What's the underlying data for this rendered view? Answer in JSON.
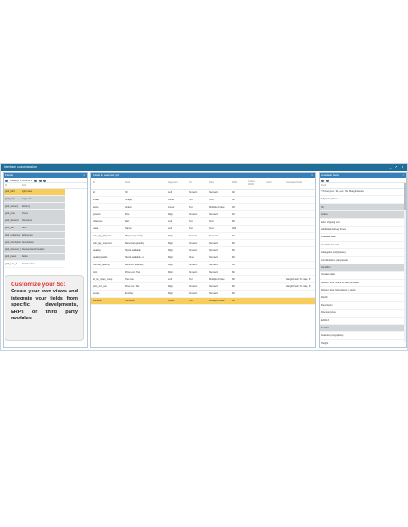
{
  "window": {
    "title": "Interface customization",
    "controls": "_ ↗ ✕"
  },
  "left_panel": {
    "header": "Fields",
    "toolbar": {
      "label": "Catalog: Products",
      "dropdown": "▾"
    },
    "columns": [
      "Id",
      "Field"
    ],
    "rows": [
      {
        "id": "grid_label",
        "field": "Light view",
        "style": "hl"
      },
      {
        "id": "grid_large",
        "field": "Large view",
        "style": "grey"
      },
      {
        "id": "grid_delivery",
        "field": "Delivery",
        "style": "grey"
      },
      {
        "id": "grid_price",
        "field": "Prices",
        "style": "grey"
      },
      {
        "id": "grid_discount",
        "field": "Discounts",
        "style": "grey"
      },
      {
        "id": "grid_seo",
        "field": "SEO",
        "style": "grey"
      },
      {
        "id": "grid_reference",
        "field": "References",
        "style": "grey"
      },
      {
        "id": "grid_description",
        "field": "Descriptions",
        "style": "grey"
      },
      {
        "id": "grid_discount_headers",
        "field": "Discounts and headers",
        "style": "grey"
      },
      {
        "id": "grid_packs",
        "field": "Packs",
        "style": "grey"
      },
      {
        "id": "grid_user_1",
        "field": "Custom view",
        "style": ""
      }
    ]
  },
  "promo": {
    "title": "Customize your Sc:",
    "body": "Create your own views and integrate your fields from specific develpments, ERPs or third party modules"
  },
  "center_panel": {
    "header": "Fields in selected grid",
    "columns": [
      "ID",
      "Field",
      "Alignment",
      "Sort",
      "Filter",
      "Width",
      "Column Width",
      "Color",
      "Associated fields"
    ],
    "rows": [
      {
        "id": "id",
        "field": "ID",
        "align": "Left",
        "sort": "Numeric",
        "filter": "Numeric",
        "width": "40",
        "assoc": "",
        "style": ""
      },
      {
        "id": "image",
        "field": "Image",
        "align": "Center",
        "sort": "Text",
        "filter": "Text",
        "width": "60",
        "assoc": "",
        "style": ""
      },
      {
        "id": "active",
        "field": "Active",
        "align": "Center",
        "sort": "Text",
        "filter": "Multiple choice",
        "width": "45",
        "assoc": "",
        "style": ""
      },
      {
        "id": "position",
        "field": "Pos.",
        "align": "Right",
        "sort": "Numeric",
        "filter": "Numeric",
        "width": "40",
        "assoc": "",
        "style": ""
      },
      {
        "id": "reference",
        "field": "Ref.",
        "align": "Left",
        "sort": "Text",
        "filter": "Text",
        "width": "80",
        "assoc": "",
        "style": ""
      },
      {
        "id": "name",
        "field": "Name",
        "align": "Left",
        "sort": "Text",
        "filter": "Text",
        "width": "200",
        "assoc": "",
        "style": ""
      },
      {
        "id": "sold_qty_physical",
        "field": "Physical quantity",
        "align": "Right",
        "sort": "Numeric",
        "filter": "Numeric",
        "width": "60",
        "assoc": "",
        "style": ""
      },
      {
        "id": "sold_qty_reserved",
        "field": "Reserved quantity",
        "align": "Right",
        "sort": "Numeric",
        "filter": "Numeric",
        "width": "60",
        "assoc": "",
        "style": ""
      },
      {
        "id": "quantity",
        "field": "Stock available",
        "align": "Right",
        "sort": "Numeric",
        "filter": "Numeric",
        "width": "60",
        "assoc": "",
        "style": ""
      },
      {
        "id": "quantityupdate",
        "field": "Stock available +/-",
        "align": "Right",
        "sort": "None",
        "filter": "Numeric",
        "width": "60",
        "assoc": "",
        "style": ""
      },
      {
        "id": "minimal_quantity",
        "field": "Minimum quantity",
        "align": "Right",
        "sort": "Numeric",
        "filter": "Numeric",
        "width": "60",
        "assoc": "",
        "style": ""
      },
      {
        "id": "price",
        "field": "Price excl. Tax",
        "align": "Right",
        "sort": "Numeric",
        "filter": "Numeric",
        "width": "60",
        "assoc": "",
        "style": ""
      },
      {
        "id": "id_tax_rules_group",
        "field": "Tax rule",
        "align": "Left",
        "sort": "Text",
        "filter": "Multiple choice",
        "width": "60",
        "assoc": "tiangle/Cost/ Tax rate, P",
        "style": ""
      },
      {
        "id": "price_inc_tax",
        "field": "Price incl. Tax",
        "align": "Right",
        "sort": "Numeric",
        "filter": "Numeric",
        "width": "60",
        "assoc": "tiangle/Cost/ Tax rate, P",
        "style": ""
      },
      {
        "id": "ecotax",
        "field": "EcoTax",
        "align": "Right",
        "sort": "Numeric",
        "filter": "Numeric",
        "width": "60",
        "assoc": "",
        "style": ""
      },
      {
        "id": "condition",
        "field": "Condition",
        "align": "Center",
        "sort": "Text",
        "filter": "Multiple choice",
        "width": "60",
        "assoc": "",
        "style": "hl"
      }
    ]
  },
  "right_panel": {
    "header": "Available fields",
    "column": "Field",
    "rows": [
      {
        "label": "* Prices (exc. Tax, exc. Tax, Margin, Ecota",
        "style": ""
      },
      {
        "label": "* Specific prices",
        "style": ""
      },
      {
        "label": "ID",
        "style": "grey"
      },
      {
        "label": "Active",
        "style": "grey"
      },
      {
        "label": "Add. shipping cost",
        "style": ""
      },
      {
        "label": "Additional delivery times",
        "style": ""
      },
      {
        "label": "Available date",
        "style": ""
      },
      {
        "label": "Available for order",
        "style": ""
      },
      {
        "label": "Categories (copy/paste)",
        "style": ""
      },
      {
        "label": "Combinations (copy/paste)",
        "style": ""
      },
      {
        "label": "Condition",
        "style": "grey"
      },
      {
        "label": "Creation date",
        "style": ""
      },
      {
        "label": "Delivery time for out of stock products",
        "style": ""
      },
      {
        "label": "Delivery time for products in stock",
        "style": ""
      },
      {
        "label": "Depth",
        "style": ""
      },
      {
        "label": "Description",
        "style": ""
      },
      {
        "label": "Discount price",
        "style": ""
      },
      {
        "label": "EAN13",
        "style": ""
      },
      {
        "label": "EcoTax",
        "style": "grey"
      },
      {
        "label": "Features (copy/paste)",
        "style": ""
      },
      {
        "label": "Height",
        "style": ""
      },
      {
        "label": "Id_product_redirected / Id_category_redirected",
        "style": ""
      },
      {
        "label": "If out of stock",
        "style": ""
      },
      {
        "label": "Image",
        "style": "grey"
      }
    ]
  }
}
